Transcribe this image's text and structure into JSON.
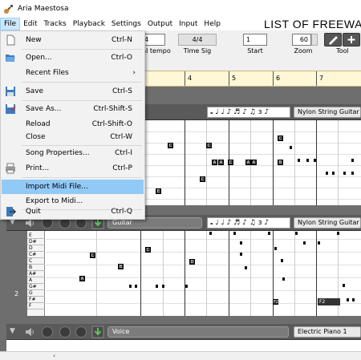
{
  "window": {
    "title": "Aria Maestosa"
  },
  "banner": "LIST OF FREEWARE",
  "menubar": [
    "File",
    "Edit",
    "Tracks",
    "Playback",
    "Settings",
    "Output",
    "Input",
    "Help"
  ],
  "toolbar": {
    "tempo_value": "4",
    "tempo_label": "al tempo",
    "timesig_value": "4/4",
    "timesig_label": "Time Sig",
    "start_value": "1",
    "start_label": "Start",
    "zoom_value": "60",
    "zoom_label": "Zoom",
    "tool_label": "Tool"
  },
  "timeline": [
    "4",
    "5",
    "6",
    "7"
  ],
  "file_menu": [
    {
      "label": "New",
      "shortcut": "Ctrl-N",
      "icon": "new-file-icon"
    },
    {
      "label": "Open...",
      "shortcut": "Ctrl-O",
      "icon": "open-folder-icon"
    },
    {
      "label": "Recent Files",
      "shortcut": "",
      "icon": ""
    },
    {
      "label": "Save",
      "shortcut": "Ctrl-S",
      "icon": "save-icon"
    },
    {
      "label": "Save As...",
      "shortcut": "Ctrl-Shift-S",
      "icon": "save-as-icon"
    },
    {
      "label": "Reload",
      "shortcut": "Ctrl-Shift-O",
      "icon": ""
    },
    {
      "label": "Close",
      "shortcut": "Ctrl-W",
      "icon": ""
    },
    {
      "label": "Song Properties...",
      "shortcut": "Ctrl-I",
      "icon": ""
    },
    {
      "label": "Print...",
      "shortcut": "Ctrl-P",
      "icon": "printer-icon"
    },
    {
      "label": "Import Midi File...",
      "shortcut": "",
      "icon": ""
    },
    {
      "label": "Export to Midi...",
      "shortcut": "",
      "icon": ""
    },
    {
      "label": "Quit",
      "shortcut": "Ctrl-Q",
      "icon": "quit-icon"
    }
  ],
  "tracks": [
    {
      "name": "",
      "instrument": "Nylon String Guitar",
      "note_symbols": "𝅝 ♩ ♩ ♪ ♬ ♪ ♫   ɜ  ♪"
    },
    {
      "name": "Guitar",
      "instrument": "Nylon String Guitar",
      "note_symbols": "𝅝 ♩ ♩ ♪ ♬ ♪ ♫   ɜ  ♪"
    },
    {
      "name": "Voice",
      "instrument": "Electric Piano 1",
      "note_symbols": ""
    }
  ],
  "track2_keys": [
    "E",
    "D#",
    "D",
    "C#",
    "C",
    "B",
    "A#",
    "A",
    "G#",
    "G",
    "F#",
    "F"
  ],
  "track2_measure": "2",
  "track1_notes": [
    "C",
    "C",
    "C",
    "A",
    "A",
    "A",
    "A",
    "B",
    "E",
    "C",
    "C",
    "A",
    "A",
    "F",
    "D"
  ],
  "track2_notes": [
    "C",
    "A",
    "B",
    "C",
    "D",
    "D",
    "D",
    "D",
    "F2"
  ],
  "accent_color": "#91c9f7"
}
